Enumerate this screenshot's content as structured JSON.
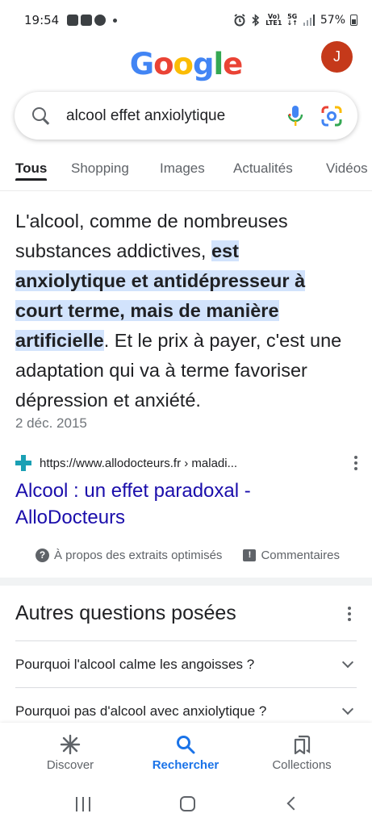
{
  "status_bar": {
    "time": "19:54",
    "network_top": "Vo)",
    "network_bottom": "LTE1",
    "net_5g": "5G",
    "battery": "57%"
  },
  "header": {
    "logo_letters": [
      "G",
      "o",
      "o",
      "g",
      "l",
      "e"
    ],
    "avatar_initial": "J",
    "avatar_color": "#c5391a"
  },
  "search": {
    "query": "alcool effet anxiolytique"
  },
  "tabs": [
    {
      "label": "Tous",
      "active": true
    },
    {
      "label": "Shopping",
      "active": false
    },
    {
      "label": "Images",
      "active": false
    },
    {
      "label": "Actualités",
      "active": false
    },
    {
      "label": "Vidéos",
      "active": false
    }
  ],
  "snippet": {
    "text_before": "L'alcool, comme de nombreuses substances addictives, ",
    "highlight": "est anxiolytique et antidépresseur à court terme, mais de manière artificielle",
    "text_after": ". Et le prix à payer, c'est une adaptation qui va à terme favoriser dépression et anxiété.",
    "date": "2 déc. 2015"
  },
  "result": {
    "url": "https://www.allodocteurs.fr › maladi...",
    "title": "Alcool : un effet paradoxal - AlloDocteurs"
  },
  "meta": {
    "about_label": "À propos des extraits optimisés",
    "feedback_label": "Commentaires"
  },
  "paa": {
    "title": "Autres questions posées",
    "questions": [
      "Pourquoi l'alcool calme les angoisses ?",
      "Pourquoi pas d'alcool avec anxiolytique ?"
    ]
  },
  "bottom_nav": [
    {
      "label": "Discover",
      "icon": "asterisk-icon",
      "active": false
    },
    {
      "label": "Rechercher",
      "icon": "search-icon",
      "active": true
    },
    {
      "label": "Collections",
      "icon": "collections-icon",
      "active": false
    }
  ],
  "colors": {
    "link": "#1a0dab",
    "highlight_bg": "#d2e3fc",
    "accent": "#1a73e8"
  }
}
